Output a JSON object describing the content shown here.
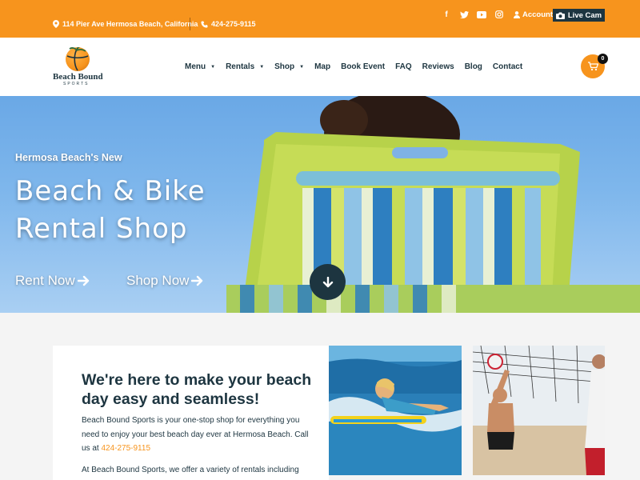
{
  "topbar": {
    "address": "114 Pier Ave Hermosa Beach, California",
    "phone": "424-275-9115",
    "social_icons": [
      "facebook-icon",
      "twitter-icon",
      "youtube-icon",
      "instagram-icon"
    ],
    "account_label": "Account",
    "livecam_label": "Live Cam"
  },
  "header": {
    "logo_name": "Beach Bound",
    "logo_sub": "SPORTS",
    "nav": [
      {
        "label": "Menu",
        "dropdown": true
      },
      {
        "label": "Rentals",
        "dropdown": true
      },
      {
        "label": "Shop",
        "dropdown": true
      },
      {
        "label": "Map",
        "dropdown": false
      },
      {
        "label": "Book Event",
        "dropdown": false
      },
      {
        "label": "FAQ",
        "dropdown": false
      },
      {
        "label": "Reviews",
        "dropdown": false
      },
      {
        "label": "Blog",
        "dropdown": false
      },
      {
        "label": "Contact",
        "dropdown": false
      }
    ],
    "cart_count": "0"
  },
  "hero": {
    "kicker": "Hermosa Beach's New",
    "title": "Beach & Bike Rental Shop",
    "rent_now": "Rent Now",
    "shop_now": "Shop Now"
  },
  "content": {
    "title": "We're here to make your beach day easy and seamless!",
    "p1_text": "Beach Bound Sports is your one-stop shop for everything you need to enjoy your best beach day ever at Hermosa Beach. Call us at ",
    "p1_phone": "424-275-9115",
    "p2_text": "At Beach Bound Sports, we offer a variety of rentals including"
  },
  "colors": {
    "accent": "#f7941d",
    "dark": "#1d3540",
    "background": "#f4f4f4"
  }
}
